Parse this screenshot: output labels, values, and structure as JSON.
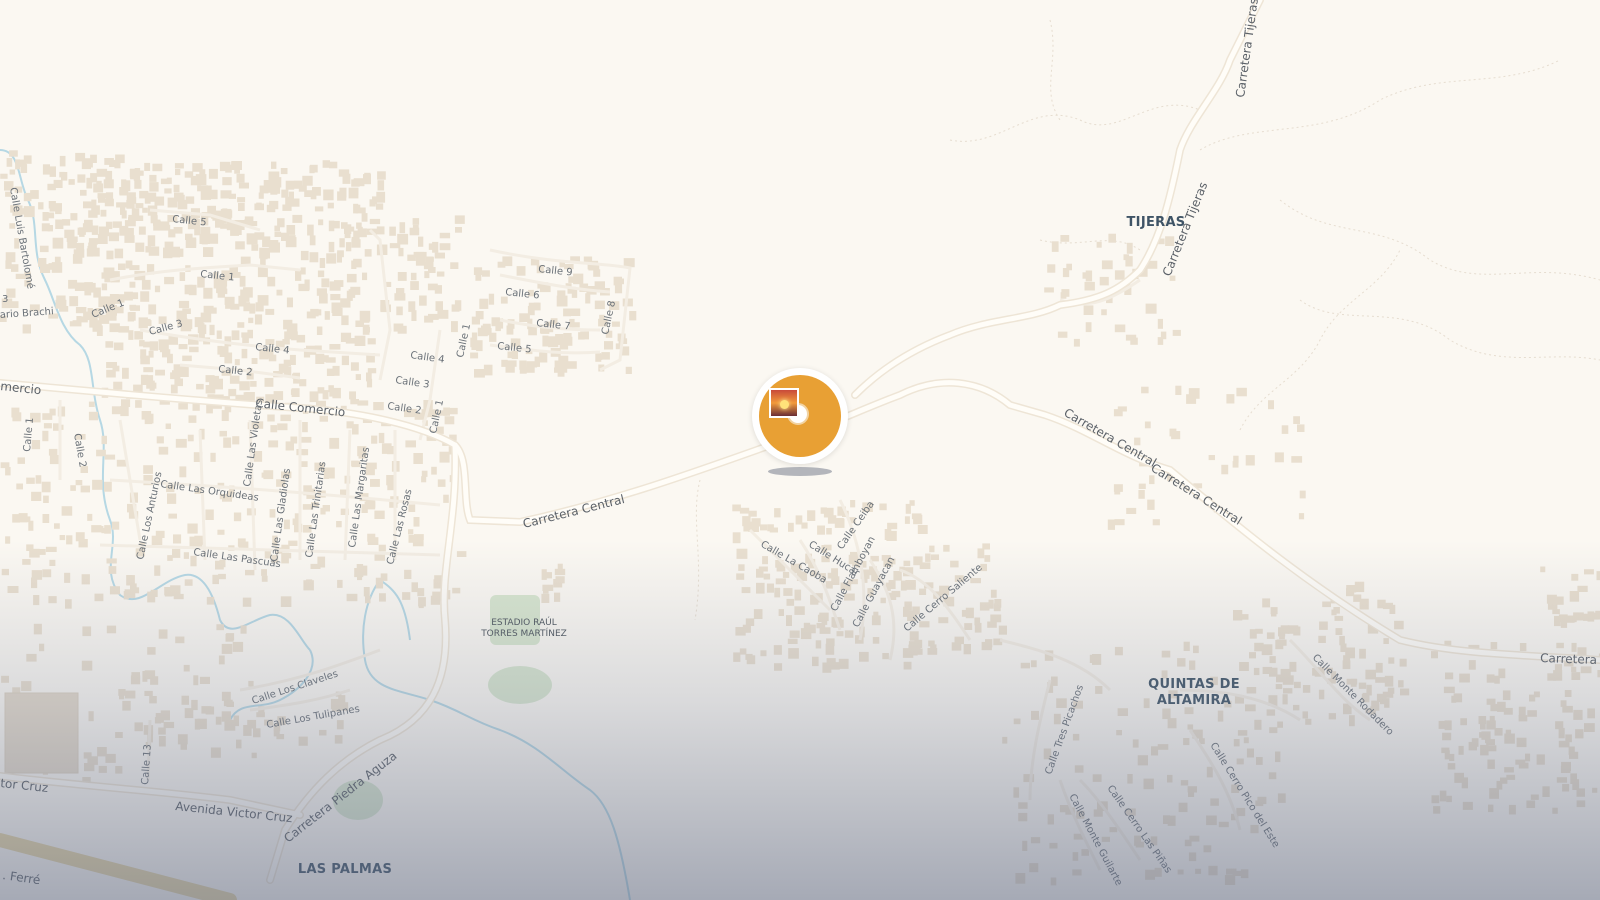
{
  "map": {
    "marker": {
      "kind": "photo-gallery-marker",
      "icon": "sunset-photo-icon",
      "color": "#e8a034"
    },
    "area_labels": [
      "TIJERAS",
      "QUINTAS DE",
      "ALTAMIRA",
      "LAS PALMAS"
    ],
    "landmarks": [
      "ESTADIO RAÚL",
      "TORRES MARTÍNEZ"
    ],
    "major_roads": [
      "Calle Comercio",
      "Carretera Central",
      "Carretera Central",
      "Carretera Central",
      "Carretera Tijeras",
      "Carretera Tijeras",
      "Avenida Victor Cruz",
      "Carretera Piedra Aguza",
      "tor Cruz",
      "Carretera C",
      "mercio",
      ". Ferré"
    ],
    "streets": [
      "Calle 5",
      "Calle 1",
      "Calle 1",
      "Calle 3",
      "Calle 4",
      "Calle 2",
      "Calle 9",
      "Calle 6",
      "Calle 7",
      "Calle 5",
      "Calle 8",
      "Calle 4",
      "Calle 3",
      "Calle 2",
      "Calle 1",
      "Calle 1",
      "Calle 2",
      "Calle 1",
      "Calle Las Violetas",
      "Calle Las Orquideas",
      "Calle Los Anturios",
      "Calle Las Gladiolas",
      "Calle Las Trinitarias",
      "Calle Las Margaritas",
      "Calle Las Rosas",
      "Calle Las Pascuas",
      "Calle Los Claveles",
      "Calle Los Tulipanes",
      "Calle 13",
      "Calle La Caoba",
      "Calle Hucar",
      "Calle Ceiba",
      "Calle Flamboyan",
      "Calle Guayacan",
      "Calle Cerro Saliente",
      "Calle Tres Picachos",
      "Calle Monte Guilarte",
      "Calle Cerro Las Piñas",
      "Calle Cerro Pico del Este",
      "Calle Monte Rodadero",
      "Calle Luis Bartolomé",
      "ario Brachi",
      "3"
    ]
  },
  "colors": {
    "land": "#fbf8f2",
    "road": "#ffffff",
    "road_casing": "#ede3d3",
    "buildings": "#e9dfcf",
    "water": "#b6d8e4",
    "park": "#d8e6cf",
    "label": "#6a7178",
    "area_label": "#3f5466"
  }
}
